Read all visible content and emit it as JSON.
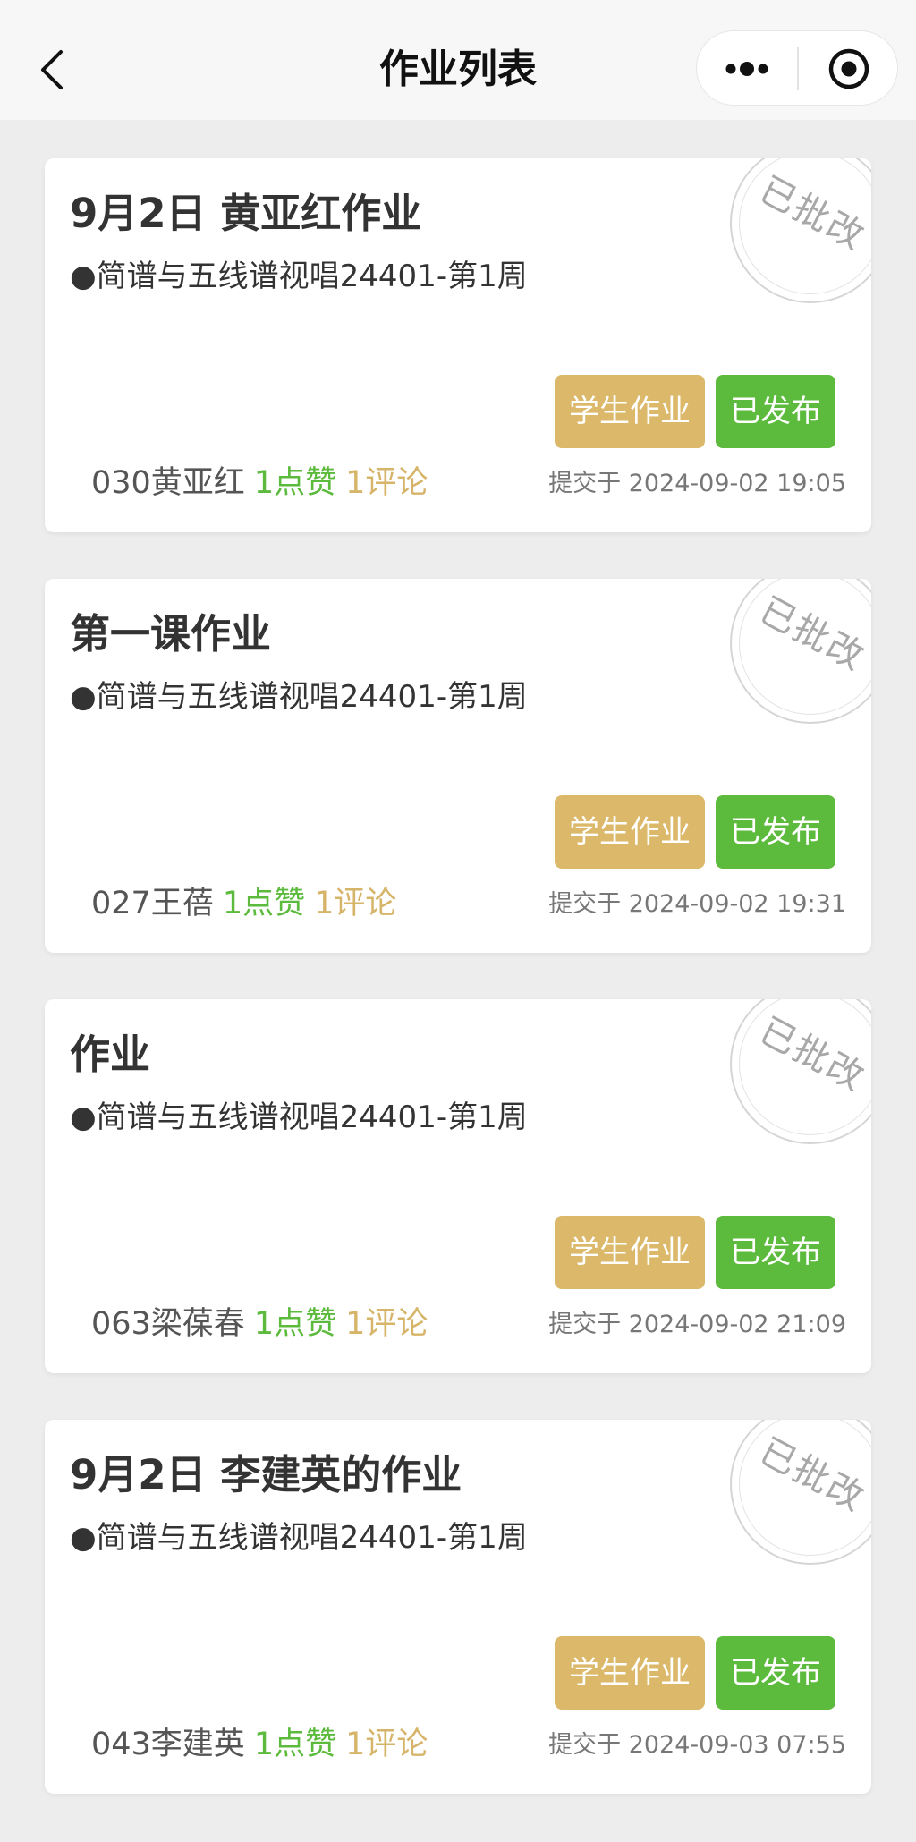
{
  "nav": {
    "title": "作业列表",
    "back_icon": "back-chevron-icon",
    "more_icon": "more-dots-icon",
    "close_icon": "target-circle-icon"
  },
  "colors": {
    "homework_button": "#dcb96a",
    "published_button": "#5cba3c",
    "likes_text": "#5cba3c",
    "comments_text": "#d6b56a"
  },
  "cards": [
    {
      "title": "9月2日 黄亚红作业",
      "course": "●简谱与五线谱视唱24401-第1周",
      "stamp": "已批改",
      "homework_button": "学生作业",
      "status_button": "已发布",
      "student": "030黄亚红",
      "likes": "1点赞",
      "comments": "1评论",
      "submitted": "提交于 2024-09-02 19:05"
    },
    {
      "title": "第一课作业",
      "course": "●简谱与五线谱视唱24401-第1周",
      "stamp": "已批改",
      "homework_button": "学生作业",
      "status_button": "已发布",
      "student": "027王蓓",
      "likes": "1点赞",
      "comments": "1评论",
      "submitted": "提交于 2024-09-02 19:31"
    },
    {
      "title": "作业",
      "course": "●简谱与五线谱视唱24401-第1周",
      "stamp": "已批改",
      "homework_button": "学生作业",
      "status_button": "已发布",
      "student": "063梁葆春",
      "likes": "1点赞",
      "comments": "1评论",
      "submitted": "提交于 2024-09-02 21:09"
    },
    {
      "title": "9月2日 李建英的作业",
      "course": "●简谱与五线谱视唱24401-第1周",
      "stamp": "已批改",
      "homework_button": "学生作业",
      "status_button": "已发布",
      "student": "043李建英",
      "likes": "1点赞",
      "comments": "1评论",
      "submitted": "提交于 2024-09-03 07:55"
    }
  ]
}
